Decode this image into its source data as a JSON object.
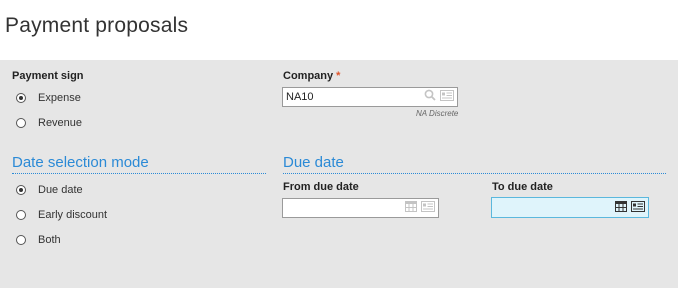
{
  "page": {
    "title": "Payment proposals"
  },
  "payment_sign": {
    "label": "Payment sign",
    "options": [
      {
        "label": "Expense",
        "checked": true
      },
      {
        "label": "Revenue",
        "checked": false
      }
    ]
  },
  "company": {
    "label": "Company",
    "required_mark": "*",
    "value": "NA10",
    "hint": "NA Discrete"
  },
  "date_selection_mode": {
    "title": "Date selection mode",
    "options": [
      {
        "label": "Due date",
        "checked": true
      },
      {
        "label": "Early discount",
        "checked": false
      },
      {
        "label": "Both",
        "checked": false
      }
    ]
  },
  "due_date": {
    "title": "Due date",
    "from_label": "From due date",
    "from_value": "",
    "to_label": "To due date",
    "to_value": ""
  },
  "colors": {
    "accent": "#2b8ad6",
    "panel": "#e6e6e6",
    "required": "#e0542a",
    "focused_field": "#dff4fb"
  },
  "icons": {
    "lookup": "search-icon",
    "detail": "list-card-icon",
    "calendar": "calendar-icon"
  }
}
